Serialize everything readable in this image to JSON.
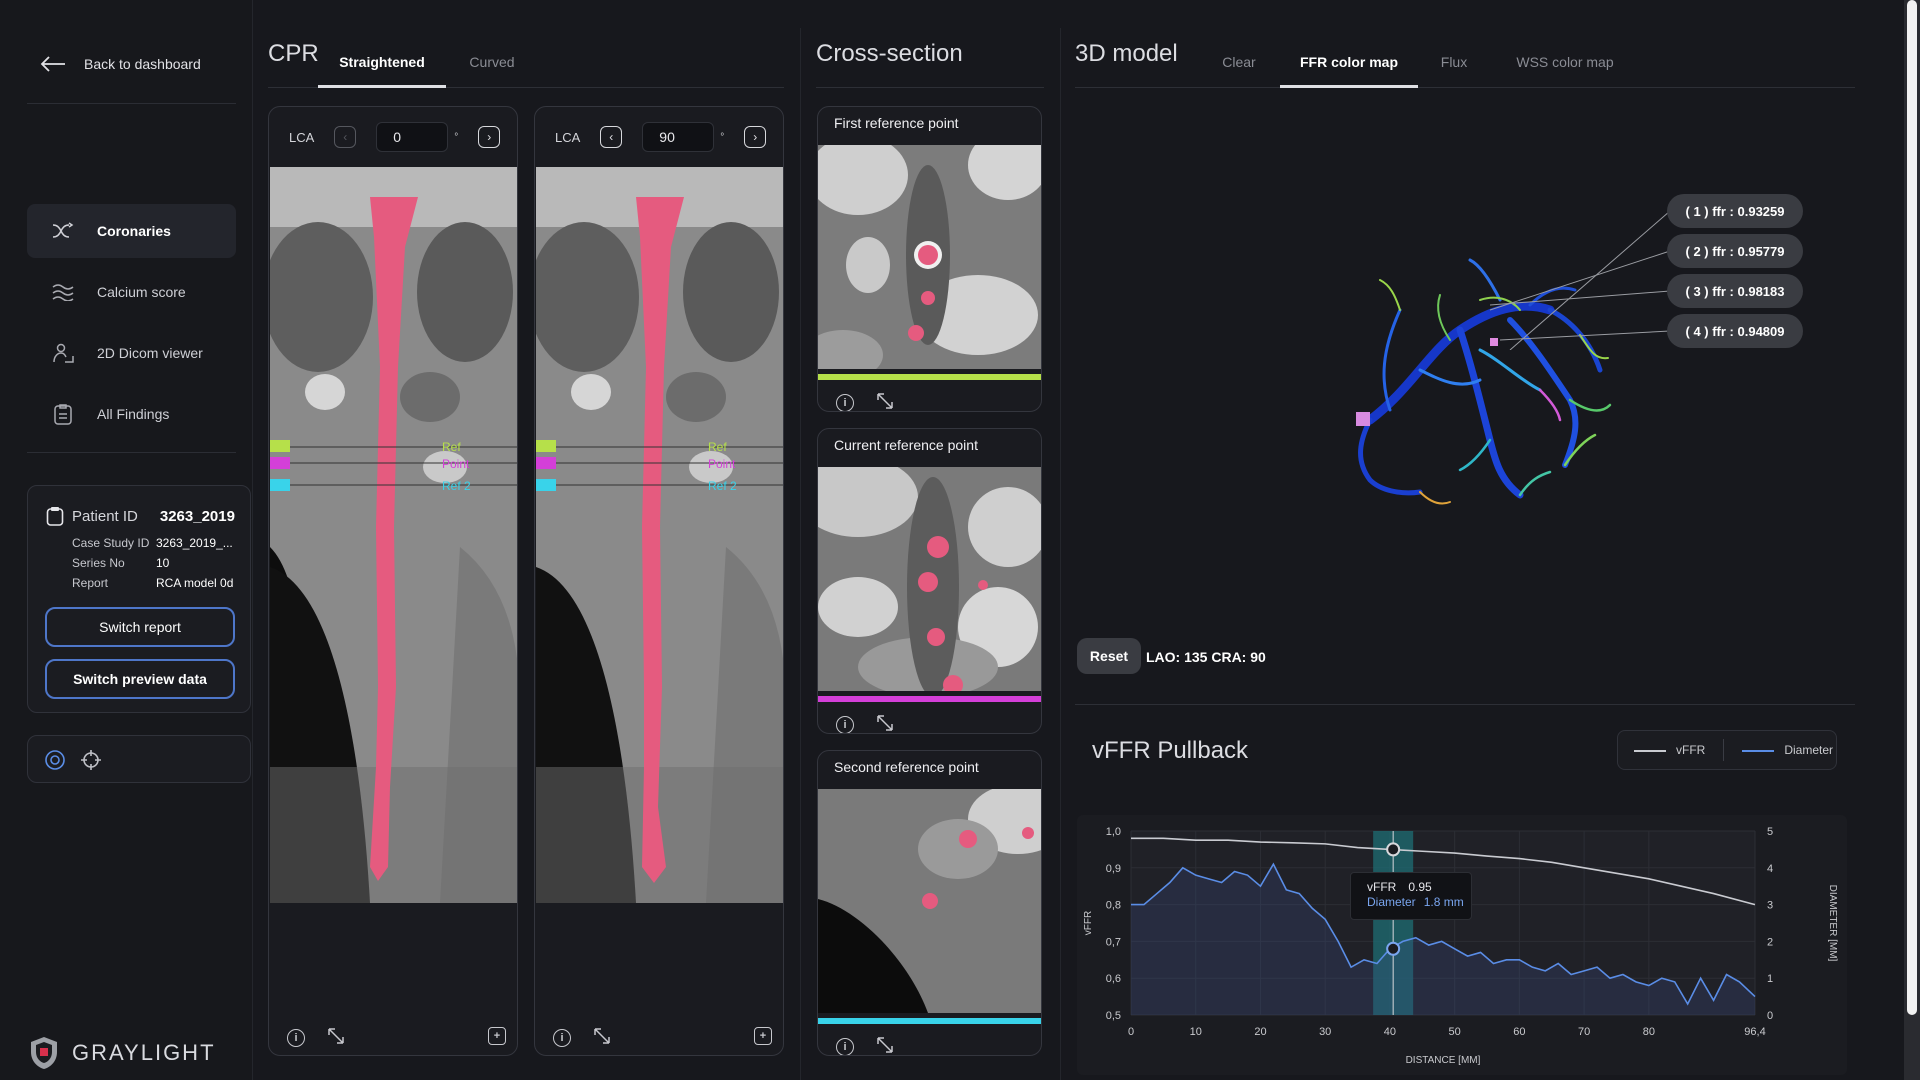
{
  "sidebar": {
    "back_label": "Back to dashboard",
    "nav": [
      {
        "label": "Coronaries",
        "icon": "coronaries-icon",
        "active": true
      },
      {
        "label": "Calcium score",
        "icon": "calcium-icon",
        "active": false
      },
      {
        "label": "2D Dicom viewer",
        "icon": "dicom-viewer-icon",
        "active": false
      },
      {
        "label": "All Findings",
        "icon": "findings-icon",
        "active": false
      }
    ],
    "patient": {
      "label": "Patient ID",
      "id": "3263_2019",
      "case_label": "Case Study ID",
      "case_value": "3263_2019_...",
      "series_label": "Series No",
      "series_value": "10",
      "report_label": "Report",
      "report_value": "RCA model 0d"
    },
    "switch_report": "Switch report",
    "switch_preview": "Switch preview data",
    "logo": "GRAYLIGHT"
  },
  "cpr": {
    "title": "CPR",
    "tabs": [
      {
        "label": "Straightened",
        "active": true
      },
      {
        "label": "Curved",
        "active": false
      }
    ],
    "panels": [
      {
        "vessel": "LCA",
        "angle": "0",
        "deg": "°",
        "markers": [
          "Ref",
          "Point",
          "Ref 2"
        ]
      },
      {
        "vessel": "LCA",
        "angle": "90",
        "deg": "°",
        "markers": [
          "Ref",
          "Point",
          "Ref 2"
        ]
      }
    ]
  },
  "cross_section": {
    "title": "Cross-section",
    "cards": [
      {
        "title": "First reference point",
        "bar_color": "#b6e04a"
      },
      {
        "title": "Current reference point",
        "bar_color": "#d43fd8"
      },
      {
        "title": "Second reference point",
        "bar_color": "#39d3ea"
      }
    ]
  },
  "model3d": {
    "title": "3D model",
    "tabs": [
      {
        "label": "Clear",
        "active": false
      },
      {
        "label": "FFR color map",
        "active": true
      },
      {
        "label": "Flux",
        "active": false
      },
      {
        "label": "WSS color map",
        "active": false
      }
    ],
    "ffr_badges": [
      "( 1 ) ffr : 0.93259",
      "( 2 ) ffr : 0.95779",
      "( 3 ) ffr : 0.98183",
      "( 4 ) ffr : 0.94809"
    ],
    "reset_label": "Reset",
    "view_angles": "LAO: 135 CRA: 90"
  },
  "pullback": {
    "title": "vFFR Pullback",
    "legend_vffr": "vFFR",
    "legend_diameter": "Diameter",
    "tooltip": {
      "vffr_label": "vFFR",
      "vffr_value": "0.95",
      "diam_label": "Diameter",
      "diam_value": "1.8 mm"
    }
  },
  "chart_data": {
    "type": "line",
    "xlabel": "DISTANCE [MM]",
    "ylabel": "vFFR",
    "y2label": "DIAMETER [MM]",
    "xlim": [
      0,
      96.4
    ],
    "ylim": [
      0.5,
      1.0
    ],
    "y2lim": [
      0,
      5
    ],
    "x_ticks": [
      "0",
      "10",
      "20",
      "30",
      "40",
      "50",
      "60",
      "70",
      "80",
      "96,4"
    ],
    "x_tick_values": [
      0,
      10,
      20,
      30,
      40,
      50,
      60,
      70,
      80,
      96.4
    ],
    "y_ticks": [
      "1,0",
      "0,9",
      "0,8",
      "0,7",
      "0,6",
      "0,5"
    ],
    "y2_ticks": [
      "5",
      "4",
      "3",
      "2",
      "1",
      "0"
    ],
    "highlight_x": 40.5,
    "series": [
      {
        "name": "vFFR",
        "color": "#c9cbd1",
        "x": [
          0,
          5,
          10,
          15,
          20,
          25,
          30,
          35,
          40,
          45,
          50,
          55,
          60,
          65,
          70,
          75,
          80,
          85,
          90,
          96.4
        ],
        "y": [
          0.98,
          0.98,
          0.975,
          0.975,
          0.97,
          0.968,
          0.965,
          0.955,
          0.95,
          0.945,
          0.94,
          0.932,
          0.925,
          0.915,
          0.9,
          0.885,
          0.87,
          0.85,
          0.83,
          0.8
        ]
      },
      {
        "name": "Diameter",
        "color": "#5a8de6",
        "x": [
          0,
          2,
          4,
          6,
          8,
          10,
          12,
          14,
          16,
          18,
          20,
          22,
          24,
          26,
          28,
          30,
          32,
          34,
          36,
          38,
          40,
          42,
          44,
          46,
          48,
          50,
          52,
          54,
          56,
          58,
          60,
          62,
          64,
          66,
          68,
          70,
          72,
          74,
          76,
          78,
          80,
          82,
          84,
          86,
          88,
          90,
          92,
          94,
          96.4
        ],
        "y": [
          3.0,
          3.0,
          3.3,
          3.6,
          4.0,
          3.8,
          3.7,
          3.6,
          3.9,
          3.8,
          3.5,
          4.1,
          3.4,
          3.3,
          2.9,
          2.6,
          2.0,
          1.3,
          1.5,
          1.4,
          1.8,
          2.0,
          2.1,
          1.9,
          2.0,
          1.8,
          1.6,
          1.7,
          1.4,
          1.5,
          1.5,
          1.3,
          1.2,
          1.4,
          1.1,
          1.2,
          1.3,
          1.0,
          1.1,
          0.9,
          0.8,
          1.0,
          0.9,
          0.3,
          1.0,
          0.4,
          1.1,
          0.9,
          0.5
        ]
      }
    ]
  }
}
